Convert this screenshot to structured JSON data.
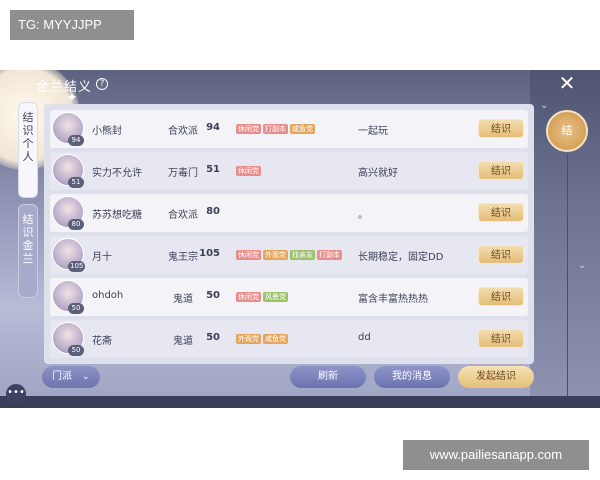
{
  "watermarks": {
    "top_left": "TG: MYYJJPP",
    "bottom_right": "www.pailiesanapp.com"
  },
  "window": {
    "title": "金兰结义",
    "help_glyph": "?",
    "close_glyph": "✕",
    "seal_label": "结"
  },
  "side_tabs": [
    {
      "label_lines": [
        "结",
        "识",
        "个",
        "人"
      ],
      "active": true
    },
    {
      "label_lines": [
        "结",
        "识",
        "金",
        "兰"
      ],
      "active": false
    }
  ],
  "rows": [
    {
      "avatar_level": "94",
      "name": "小熊封",
      "sect": "合欢派",
      "level": "94",
      "tags": [
        {
          "text": "休闲党",
          "color": "c1"
        },
        {
          "text": "打副本",
          "color": "c1"
        },
        {
          "text": "咸鱼党",
          "color": "c2"
        }
      ],
      "motto": "一起玩",
      "button": "结识"
    },
    {
      "avatar_level": "51",
      "name": "实力不允许",
      "sect": "万毒门",
      "level": "51",
      "tags": [
        {
          "text": "休闲党",
          "color": "c1"
        }
      ],
      "motto": "高兴就好",
      "button": "结识"
    },
    {
      "avatar_level": "80",
      "name": "苏苏想吃糖",
      "sect": "合欢派",
      "level": "80",
      "tags": [],
      "motto": "。",
      "button": "结识"
    },
    {
      "avatar_level": "105",
      "name": "月十",
      "sect": "鬼王宗",
      "level": "105",
      "tags": [
        {
          "text": "休闲党",
          "color": "c1"
        },
        {
          "text": "外观党",
          "color": "c2"
        },
        {
          "text": "找亲友",
          "color": "c3"
        },
        {
          "text": "打副本",
          "color": "c1"
        }
      ],
      "motto": "长期稳定，固定DD",
      "button": "结识"
    },
    {
      "avatar_level": "50",
      "name": "ohdoh",
      "sect": "鬼道",
      "level": "50",
      "tags": [
        {
          "text": "休闲党",
          "color": "c1"
        },
        {
          "text": "风景党",
          "color": "c3"
        }
      ],
      "motto": "富含丰富热热热",
      "button": "结识"
    },
    {
      "avatar_level": "50",
      "name": "花斋",
      "sect": "鬼道",
      "level": "50",
      "tags": [
        {
          "text": "外观党",
          "color": "c2"
        },
        {
          "text": "咸鱼党",
          "color": "c2"
        }
      ],
      "motto": "dd",
      "button": "结识"
    }
  ],
  "bottom": {
    "filter": "门派",
    "refresh": "刷新",
    "messages": "我的消息",
    "start": "发起结识"
  },
  "colors": {
    "accent_gold": "#e4bd78",
    "accent_purple": "#6e74ad",
    "panel": "#dee0ec"
  }
}
